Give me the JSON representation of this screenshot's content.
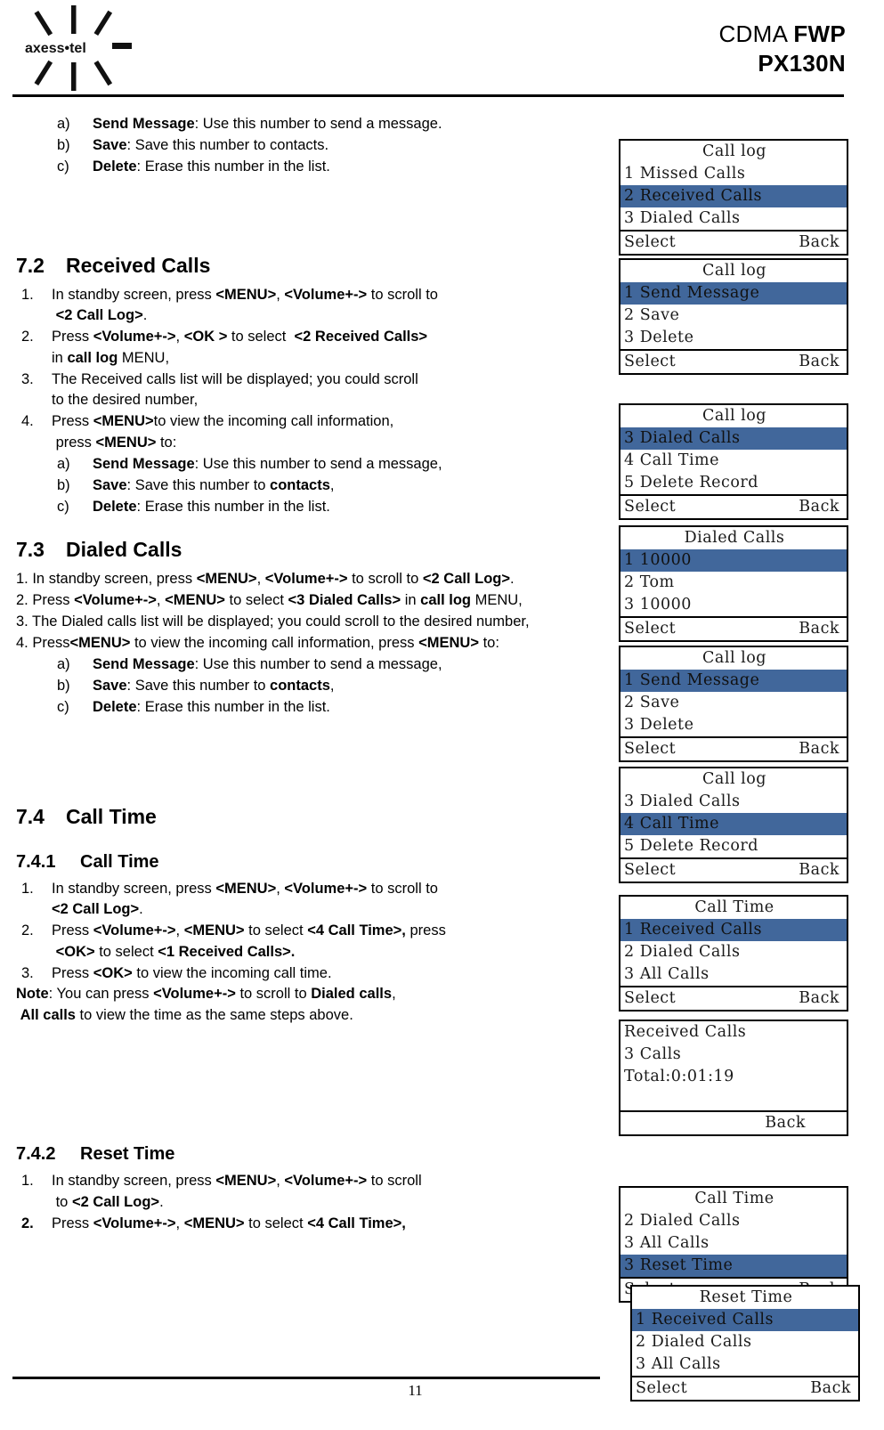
{
  "header": {
    "logo_text": "axess•tel",
    "title_line1_light": "CDMA ",
    "title_line1_bold": "FWP",
    "title_line2": "PX130N"
  },
  "footer": {
    "page_number": "11"
  },
  "intro_list": [
    {
      "marker": "a)",
      "bold": "Send Message",
      "rest": ": Use this number to send a message."
    },
    {
      "marker": "b)",
      "bold": "Save",
      "rest": ": Save this number to contacts."
    },
    {
      "marker": "c)",
      "bold": "Delete",
      "rest": ": Erase this number in the list."
    }
  ],
  "section_72": {
    "number": "7.2",
    "title": "Received Calls",
    "steps": [
      {
        "marker": "1.",
        "line1": "In standby screen, press <MENU>, <Volume+-> to scroll to",
        "line2": "<2 Call Log>."
      },
      {
        "marker": "2.",
        "line1": "Press <Volume+->, <OK > to select  <2 Received Calls>",
        "line2": "in call log MENU,"
      },
      {
        "marker": "3.",
        "line1": "The Received calls list will be displayed; you could scroll",
        "line2": "to the desired number,"
      },
      {
        "marker": "4.",
        "line1": "Press <MENU>to view the incoming call information,",
        "line2": "press <MENU> to:"
      }
    ],
    "sub_list": [
      {
        "marker": "a)",
        "bold": "Send Message",
        "rest": ": Use this number to send a message,"
      },
      {
        "marker": "b)",
        "bold": "Save",
        "rest": ": Save this number to contacts,"
      },
      {
        "marker": "c)",
        "bold": "Delete",
        "rest": ": Erase this number in the list."
      }
    ]
  },
  "section_73": {
    "number": "7.3",
    "title": "Dialed Calls",
    "paragraphs": [
      "1. In standby screen, press <MENU>, <Volume+-> to scroll to <2 Call Log>.",
      "2. Press <Volume+->, <MENU> to select <3 Dialed Calls> in call log MENU,",
      "3. The Dialed calls list will be displayed; you could scroll to the desired number,",
      "4. Press<MENU> to view the incoming call information, press <MENU> to:"
    ],
    "sub_list": [
      {
        "marker": "a)",
        "bold": "Send Message",
        "rest": ": Use this number to send a message,"
      },
      {
        "marker": "b)",
        "bold": "Save",
        "rest": ": Save this number to contacts,"
      },
      {
        "marker": "c)",
        "bold": "Delete",
        "rest": ": Erase this number in the list."
      }
    ]
  },
  "section_74": {
    "number": "7.4",
    "title": "Call Time",
    "sub_741": {
      "number": "7.4.1",
      "title": "Call Time",
      "steps": [
        {
          "marker": "1.",
          "line1": "In standby screen, press <MENU>, <Volume+-> to scroll to",
          "line2": "<2 Call Log>."
        },
        {
          "marker": "2.",
          "line1": "Press <Volume+->, <MENU> to select <4 Call Time>, press",
          "line2": "<OK> to select <1 Received Calls>."
        },
        {
          "marker": "3.",
          "line1": "Press <OK> to view the incoming call time.",
          "line2": ""
        }
      ],
      "note_line1": "Note: You can press <Volume+-> to scroll to Dialed calls,",
      "note_line2": " All calls to view the time as the same steps above."
    },
    "sub_742": {
      "number": "7.4.2",
      "title": "Reset Time",
      "steps": [
        {
          "marker": "1.",
          "line1": "In standby screen, press <MENU>, <Volume+-> to scroll",
          "line2": "to <2 Call Log>."
        },
        {
          "marker": "2.",
          "line1": "Press <Volume+->, <MENU> to select <4 Call Time>,",
          "line2": ""
        }
      ]
    }
  },
  "lcd_screens": [
    {
      "id": "call-log-received",
      "title": "Call log",
      "rows": [
        {
          "text": "1 Missed Calls",
          "highlight": false
        },
        {
          "text": "2 Received Calls",
          "highlight": true
        },
        {
          "text": "3 Dialed Calls",
          "highlight": false
        }
      ],
      "softkey_left": "Select",
      "softkey_right": "Back"
    },
    {
      "id": "call-log-options-1",
      "title": "Call log",
      "rows": [
        {
          "text": "1 Send Message",
          "highlight": true
        },
        {
          "text": "2 Save",
          "highlight": false
        },
        {
          "text": "3 Delete",
          "highlight": false
        }
      ],
      "softkey_left": "Select",
      "softkey_right": "Back"
    },
    {
      "id": "call-log-dialed",
      "title": "Call log",
      "rows": [
        {
          "text": "3 Dialed Calls",
          "highlight": true
        },
        {
          "text": "4 Call Time",
          "highlight": false
        },
        {
          "text": "5 Delete Record",
          "highlight": false
        }
      ],
      "softkey_left": "Select",
      "softkey_right": "Back"
    },
    {
      "id": "dialed-calls-list",
      "title": "Dialed Calls",
      "rows": [
        {
          "text": "1 10000",
          "highlight": true
        },
        {
          "text": "2 Tom",
          "highlight": false
        },
        {
          "text": "3 10000",
          "highlight": false
        }
      ],
      "softkey_left": "Select",
      "softkey_right": "Back"
    },
    {
      "id": "call-log-options-2",
      "title": "Call log",
      "rows": [
        {
          "text": "1 Send Message",
          "highlight": true
        },
        {
          "text": "2 Save",
          "highlight": false
        },
        {
          "text": "3 Delete",
          "highlight": false
        }
      ],
      "softkey_left": "Select",
      "softkey_right": "Back"
    },
    {
      "id": "call-log-call-time",
      "title": "Call log",
      "rows": [
        {
          "text": "3 Dialed Calls",
          "highlight": false
        },
        {
          "text": "4 Call Time",
          "highlight": true
        },
        {
          "text": "5 Delete Record",
          "highlight": false
        }
      ],
      "softkey_left": "Select",
      "softkey_right": "Back"
    },
    {
      "id": "call-time-menu",
      "title": "Call Time",
      "rows": [
        {
          "text": "1 Received Calls",
          "highlight": true
        },
        {
          "text": "2 Dialed Calls",
          "highlight": false
        },
        {
          "text": "3 All Calls",
          "highlight": false
        }
      ],
      "softkey_left": "Select",
      "softkey_right": "Back"
    },
    {
      "id": "received-calls-total",
      "title": "",
      "rows": [
        {
          "text": "Received Calls",
          "highlight": false
        },
        {
          "text": "3 Calls",
          "highlight": false
        },
        {
          "text": "Total:0:01:19",
          "highlight": false
        }
      ],
      "softkey_left": "",
      "softkey_right": "Back"
    },
    {
      "id": "call-time-reset",
      "title": "Call Time",
      "rows": [
        {
          "text": "2 Dialed Calls",
          "highlight": false
        },
        {
          "text": "3 All Calls",
          "highlight": false
        },
        {
          "text": "3 Reset Time",
          "highlight": true
        }
      ],
      "softkey_left": "Select",
      "softkey_right": "Back"
    },
    {
      "id": "reset-time-menu",
      "title": "Reset Time",
      "rows": [
        {
          "text": "1 Received Calls",
          "highlight": true
        },
        {
          "text": "2 Dialed Calls",
          "highlight": false
        },
        {
          "text": "3 All Calls",
          "highlight": false
        }
      ],
      "softkey_left": "Select",
      "softkey_right": "Back"
    }
  ]
}
